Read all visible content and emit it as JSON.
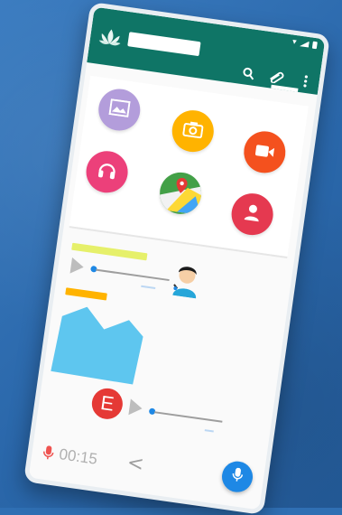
{
  "colors": {
    "background": "#2f6fb3",
    "appbar": "#0f7566",
    "accent_blue": "#1e88e5",
    "gallery": "#b39ddb",
    "camera": "#ffb300",
    "video": "#f4511e",
    "audio": "#ec407a",
    "location": "#43a047",
    "contact": "#e53950",
    "highlight_yellow": "#e6f06a",
    "highlight_orange": "#ffb300",
    "image_msg": "#5ec6ef"
  },
  "icons": {
    "logo": "lotus-logo-icon",
    "search": "search-icon",
    "attach": "paperclip-icon",
    "more": "more-vert-icon",
    "gallery": "gallery-icon",
    "camera": "camera-icon",
    "video": "video-camera-icon",
    "audio": "headphones-icon",
    "location": "location-map-icon",
    "contact": "contact-person-icon",
    "play": "play-icon",
    "mic": "microphone-icon",
    "back": "chevron-left-icon"
  },
  "message_in": {
    "avatar_letter": "E"
  },
  "bottom": {
    "timer": "00:15",
    "back_glyph": "<"
  }
}
